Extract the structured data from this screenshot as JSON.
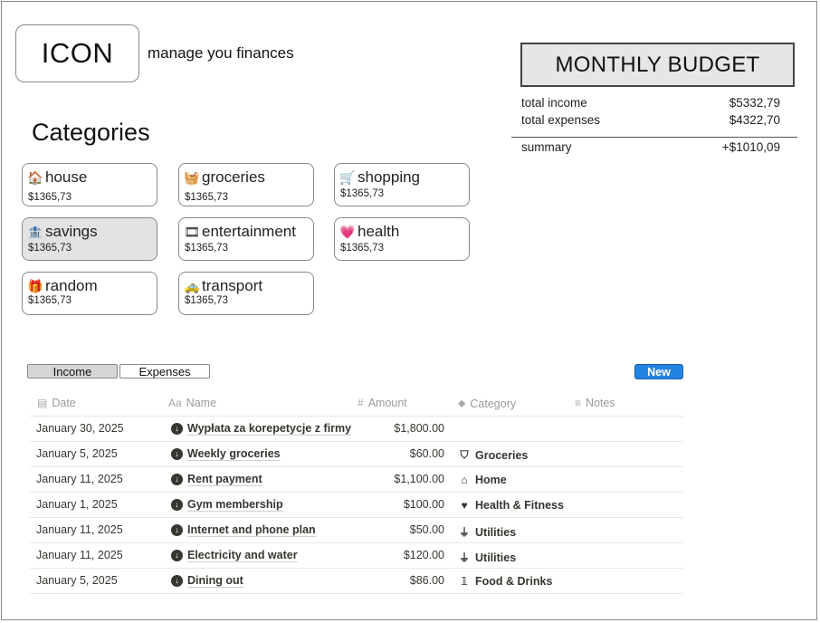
{
  "header": {
    "logo_text": "ICON",
    "tagline": "manage you finances"
  },
  "budget": {
    "title": "MONTHLY BUDGET",
    "income_label": "total income",
    "income_value": "$5332,79",
    "expenses_label": "total expenses",
    "expenses_value": "$4322,70",
    "summary_label": "summary",
    "summary_value": "+$1010,09"
  },
  "categories": {
    "heading": "Categories",
    "items": [
      {
        "label": "house",
        "amount": "$1365,73",
        "icon": "house-icon",
        "emoji": "🏠"
      },
      {
        "label": "groceries",
        "amount": "$1365,73",
        "icon": "basket-icon",
        "emoji": "🧺"
      },
      {
        "label": "shopping",
        "amount": "$1365,73",
        "icon": "cart-icon",
        "emoji": "🛒"
      },
      {
        "label": "savings",
        "amount": "$1365,73",
        "icon": "bank-icon",
        "emoji": "🏦",
        "selected": true
      },
      {
        "label": "entertainment",
        "amount": "$1365,73",
        "icon": "film-icon",
        "emoji": "🎞"
      },
      {
        "label": "health",
        "amount": "$1365,73",
        "icon": "heart-icon",
        "emoji": "💗"
      },
      {
        "label": "random",
        "amount": "$1365,73",
        "icon": "gift-icon",
        "emoji": "🎁"
      },
      {
        "label": "transport",
        "amount": "$1365,73",
        "icon": "car-icon",
        "emoji": "🚕"
      }
    ]
  },
  "table": {
    "tabs": [
      {
        "label": "Income",
        "active": true
      },
      {
        "label": "Expenses",
        "active": false
      }
    ],
    "new_label": "New",
    "columns": {
      "date": "Date",
      "name": "Name",
      "amount": "Amount",
      "category": "Category",
      "notes": "Notes"
    },
    "rows": [
      {
        "date": "January 30, 2025",
        "name": "Wypłata za korepetycje z firmy",
        "amount": "$1,800.00",
        "category": "",
        "cat_icon": ""
      },
      {
        "date": "January 5, 2025",
        "name": "Weekly groceries",
        "amount": "$60.00",
        "category": "Groceries",
        "cat_icon": "basket-icon"
      },
      {
        "date": "January 11, 2025",
        "name": "Rent payment",
        "amount": "$1,100.00",
        "category": "Home",
        "cat_icon": "home-icon"
      },
      {
        "date": "January 1, 2025",
        "name": "Gym membership",
        "amount": "$100.00",
        "category": "Health & Fitness",
        "cat_icon": "heart-icon"
      },
      {
        "date": "January 11, 2025",
        "name": "Internet and phone plan",
        "amount": "$50.00",
        "category": "Utilities",
        "cat_icon": "plug-icon"
      },
      {
        "date": "January 11, 2025",
        "name": "Electricity and water",
        "amount": "$120.00",
        "category": "Utilities",
        "cat_icon": "plug-icon"
      },
      {
        "date": "January 5, 2025",
        "name": "Dining out",
        "amount": "$86.00",
        "category": "Food & Drinks",
        "cat_icon": "utensils-icon"
      }
    ]
  }
}
